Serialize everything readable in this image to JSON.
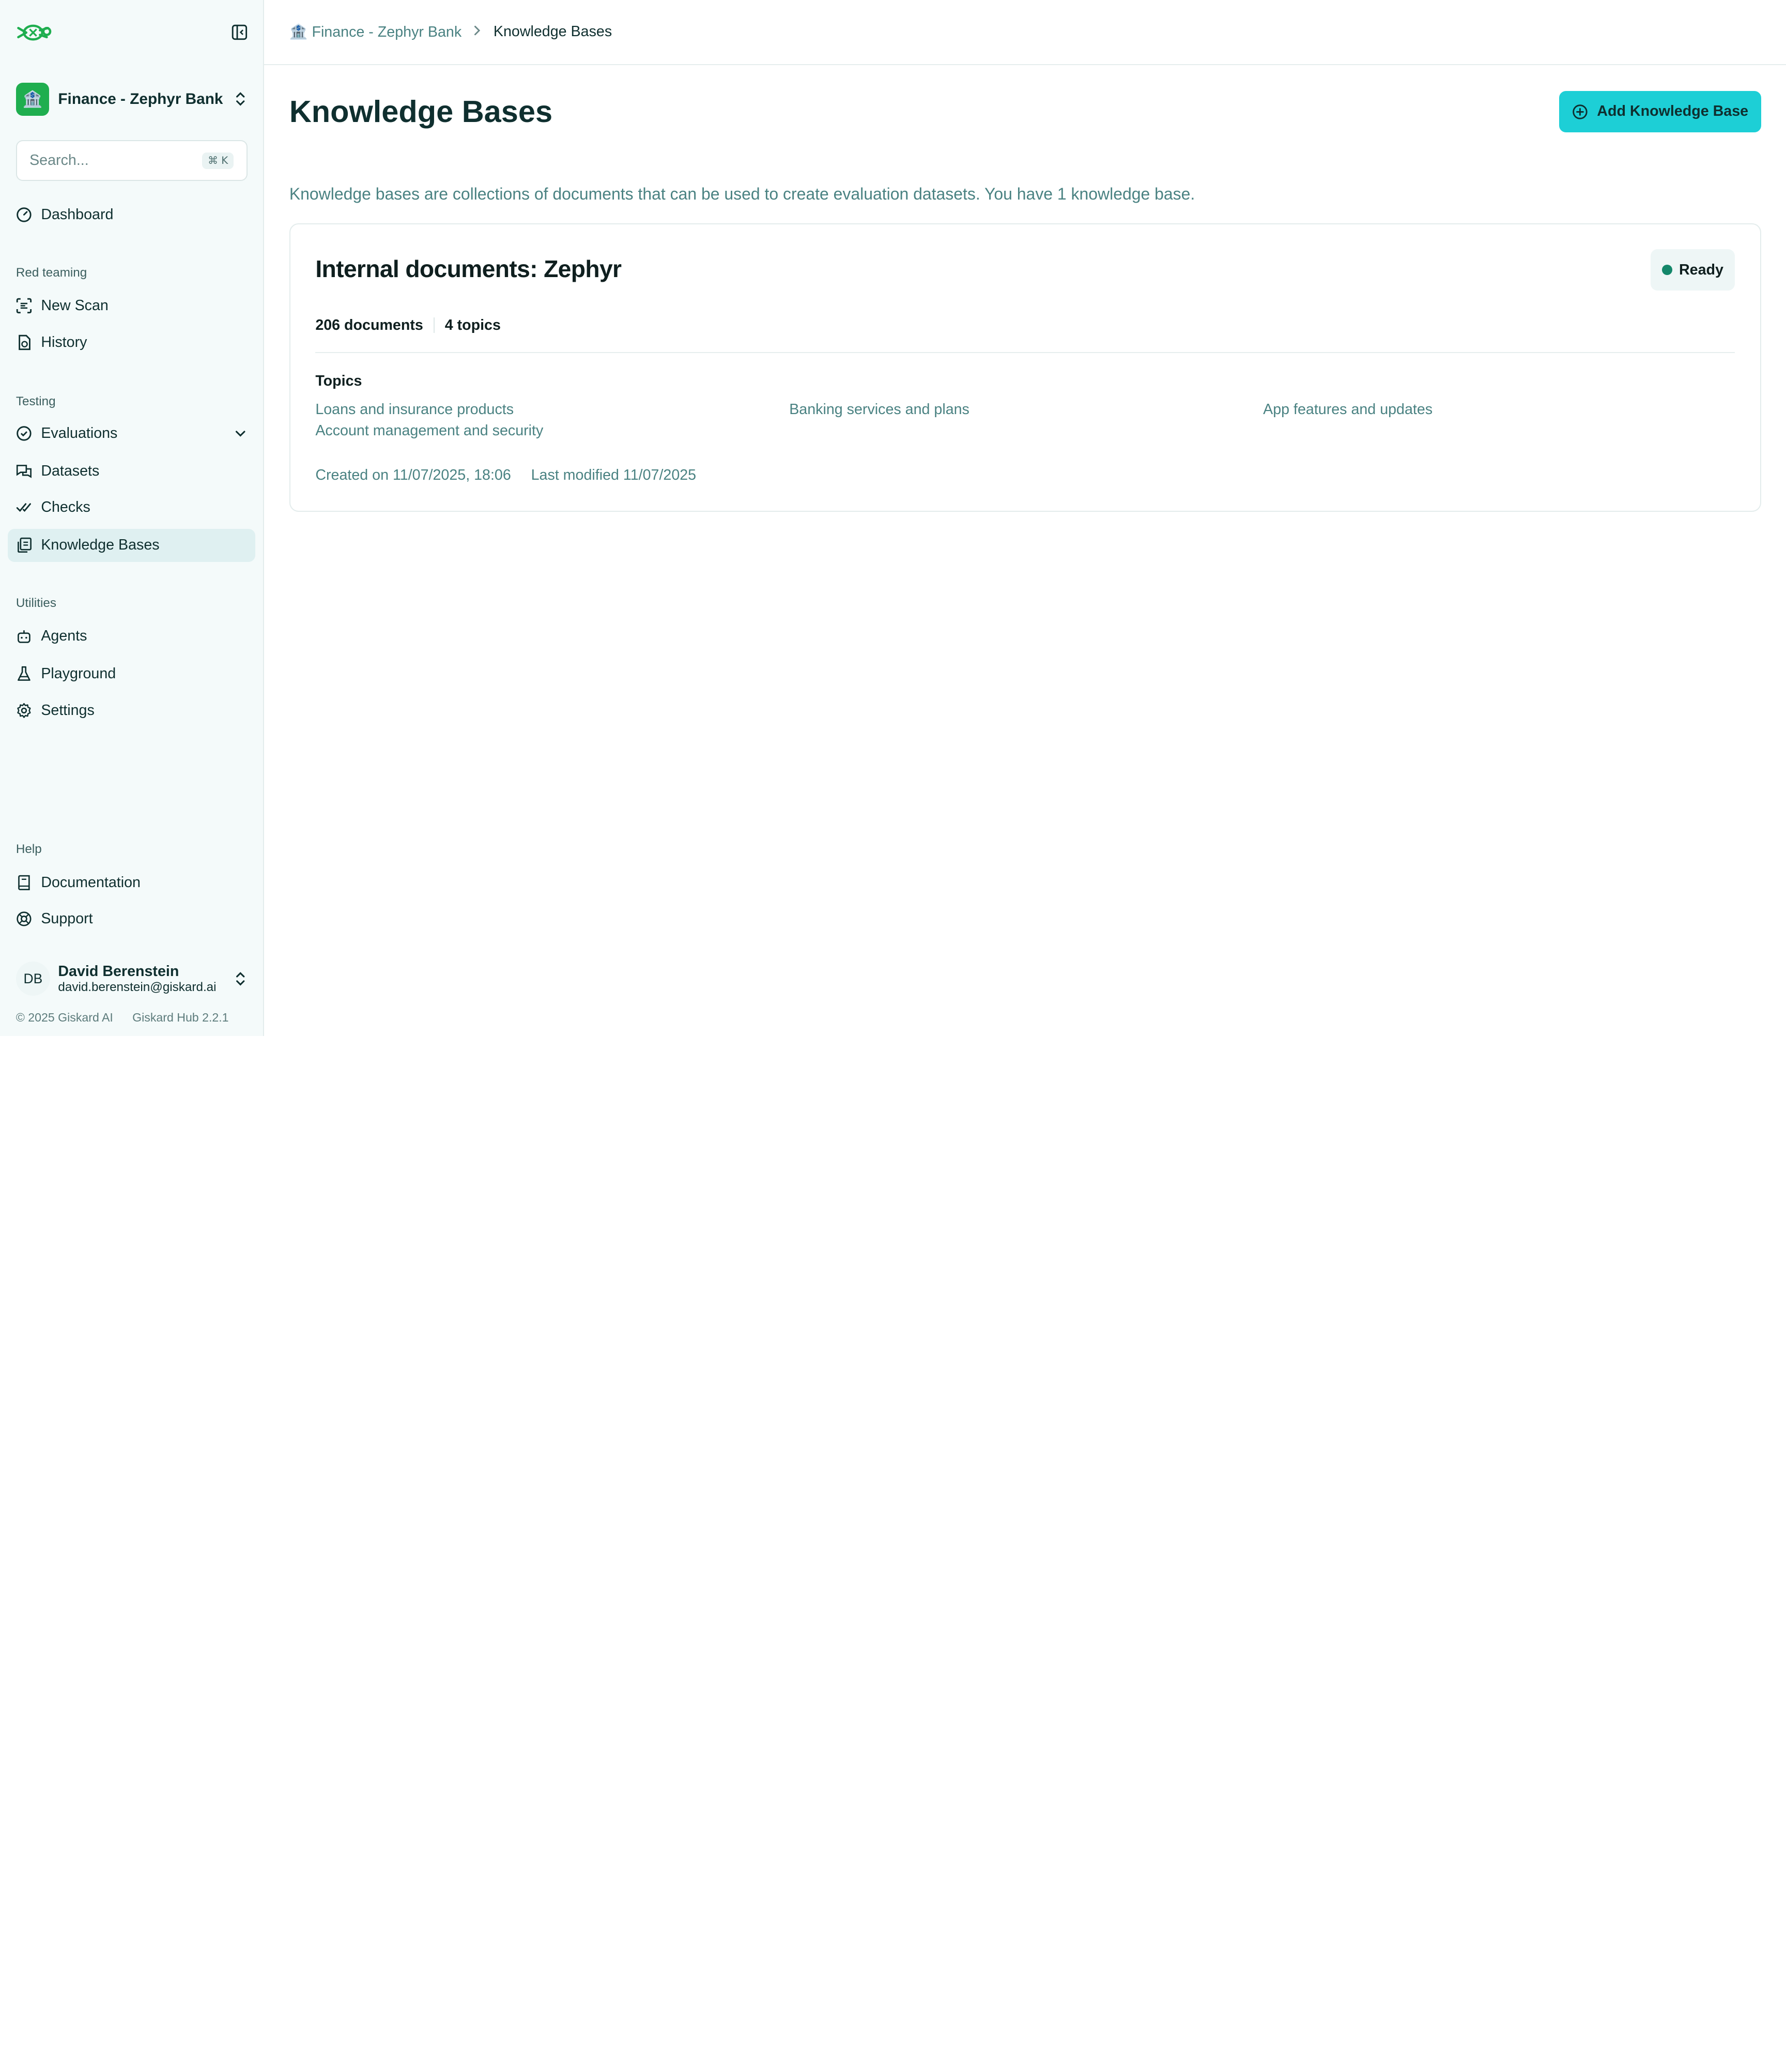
{
  "workspace": {
    "icon": "🏦",
    "name": "Finance - Zephyr Bank"
  },
  "search": {
    "placeholder": "Search...",
    "shortcut": "⌘ K"
  },
  "nav": {
    "dashboard": "Dashboard",
    "red_teaming_label": "Red teaming",
    "new_scan": "New Scan",
    "history": "History",
    "testing_label": "Testing",
    "evaluations": "Evaluations",
    "datasets": "Datasets",
    "checks": "Checks",
    "knowledge_bases": "Knowledge Bases",
    "utilities_label": "Utilities",
    "agents": "Agents",
    "playground": "Playground",
    "settings": "Settings",
    "help_label": "Help",
    "documentation": "Documentation",
    "support": "Support"
  },
  "user": {
    "initials": "DB",
    "name": "David Berenstein",
    "email": "david.berenstein@giskard.ai"
  },
  "footer": {
    "copyright": "© 2025 Giskard AI",
    "version": "Giskard Hub 2.2.1"
  },
  "breadcrumb": {
    "parent": "🏦 Finance - Zephyr Bank",
    "current": "Knowledge Bases"
  },
  "page": {
    "title": "Knowledge Bases",
    "add_button": "Add Knowledge Base",
    "description": "Knowledge bases are collections of documents that can be used to create evaluation datasets. You have 1 knowledge base."
  },
  "knowledge_base": {
    "title": "Internal documents: Zephyr",
    "status": "Ready",
    "status_color": "#14876a",
    "documents": "206 documents",
    "topics_count": "4 topics",
    "topics_label": "Topics",
    "topics": [
      "Loans and insurance products",
      "Banking services and plans",
      "App features and updates",
      "Account management and security"
    ],
    "created": "Created on 11/07/2025, 18:06",
    "modified": "Last modified 11/07/2025"
  },
  "colors": {
    "accent": "#1dcfd6",
    "brand_green": "#1fae4f",
    "text_teal": "#4a8282"
  }
}
